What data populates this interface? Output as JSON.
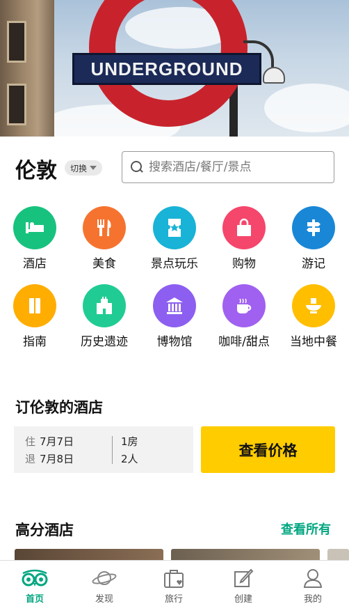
{
  "hero": {
    "sign_text": "UNDERGROUND"
  },
  "header": {
    "city": "伦敦",
    "switch_label": "切换",
    "search_placeholder": "搜索酒店/餐厅/景点"
  },
  "categories": [
    {
      "label": "酒店",
      "icon": "bed-icon",
      "color": "#17c27e"
    },
    {
      "label": "美食",
      "icon": "utensils-icon",
      "color": "#f6732f"
    },
    {
      "label": "景点玩乐",
      "icon": "ticket-icon",
      "color": "#18b3d6"
    },
    {
      "label": "购物",
      "icon": "shopping-bag-icon",
      "color": "#f5466c"
    },
    {
      "label": "游记",
      "icon": "signpost-icon",
      "color": "#1987d6"
    },
    {
      "label": "指南",
      "icon": "book-icon",
      "color": "#ffad00"
    },
    {
      "label": "历史遗迹",
      "icon": "castle-icon",
      "color": "#20cc93"
    },
    {
      "label": "博物馆",
      "icon": "museum-icon",
      "color": "#8c5ff0"
    },
    {
      "label": "咖啡/甜点",
      "icon": "coffee-icon",
      "color": "#a060f0"
    },
    {
      "label": "当地中餐",
      "icon": "bowl-icon",
      "color": "#ffbe00"
    }
  ],
  "booking": {
    "title": "订伦敦的酒店",
    "checkin_key": "住",
    "checkin_date": "7月7日",
    "checkout_key": "退",
    "checkout_date": "7月8日",
    "rooms": "1房",
    "guests": "2人",
    "price_button": "查看价格"
  },
  "top_hotels": {
    "title": "高分酒店",
    "see_all": "查看所有"
  },
  "tabs": [
    {
      "label": "首页",
      "icon": "owl-icon",
      "active": true
    },
    {
      "label": "发现",
      "icon": "planet-icon",
      "active": false
    },
    {
      "label": "旅行",
      "icon": "suitcase-icon",
      "active": false
    },
    {
      "label": "创建",
      "icon": "edit-icon",
      "active": false
    },
    {
      "label": "我的",
      "icon": "user-icon",
      "active": false
    }
  ],
  "colors": {
    "accent": "#00a680",
    "cta": "#ffcc00"
  }
}
